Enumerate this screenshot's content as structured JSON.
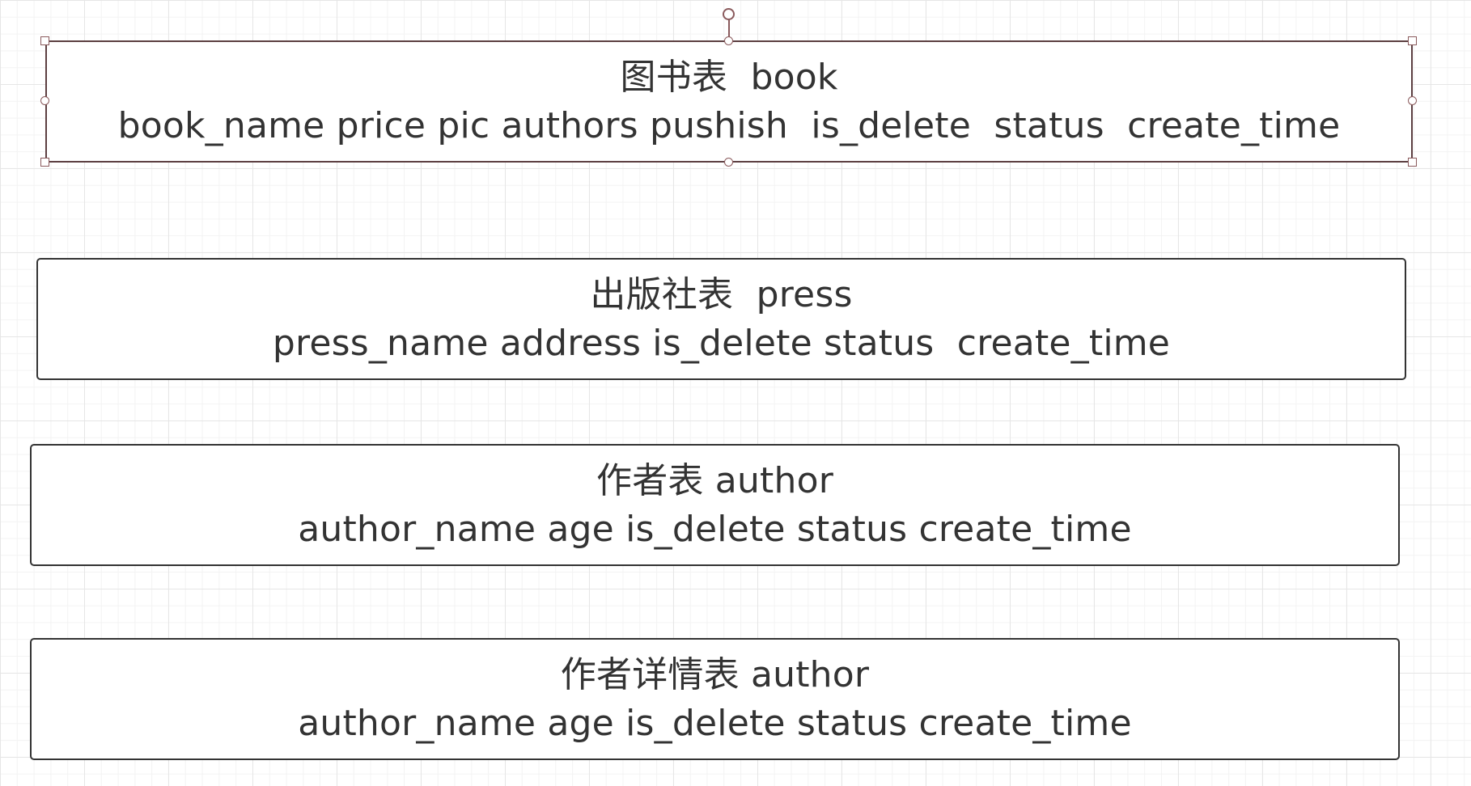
{
  "diagram": {
    "tables": [
      {
        "title": "图书表  book",
        "fields": "book_name price pic authors pushish  is_delete  status  create_time",
        "selected": true
      },
      {
        "title": "出版社表  press",
        "fields": "press_name address is_delete status  create_time",
        "selected": false
      },
      {
        "title": "作者表 author",
        "fields": "author_name age is_delete status create_time",
        "selected": false
      },
      {
        "title": "作者详情表 author",
        "fields": "author_name age is_delete status create_time",
        "selected": false
      }
    ]
  },
  "colors": {
    "border": "#333333",
    "selection": "#8a5a5c",
    "grid": "#e6e6e6"
  },
  "icons": {
    "rotate": "rotate-handle-icon",
    "resize": "resize-handle-icon"
  }
}
